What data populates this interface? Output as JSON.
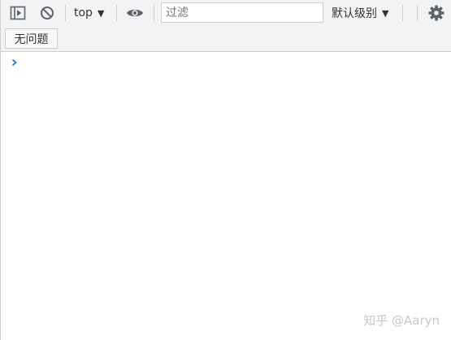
{
  "toolbar": {
    "sidebar_icon": "sidebar-toggle-icon",
    "clear_icon": "clear-console-icon",
    "context": "top",
    "eye_icon": "eye-icon",
    "filter_placeholder": "过滤",
    "levels": "默认级别",
    "settings_icon": "gear-icon"
  },
  "subbar": {
    "issues_label": "无问题"
  },
  "console": {
    "prompt_icon": "chevron-right-icon"
  },
  "watermark": "知乎 @Aaryn",
  "colors": {
    "toolbar_bg": "#f1f3f4",
    "icon": "#5f6368",
    "prompt": "#1a73e8"
  }
}
